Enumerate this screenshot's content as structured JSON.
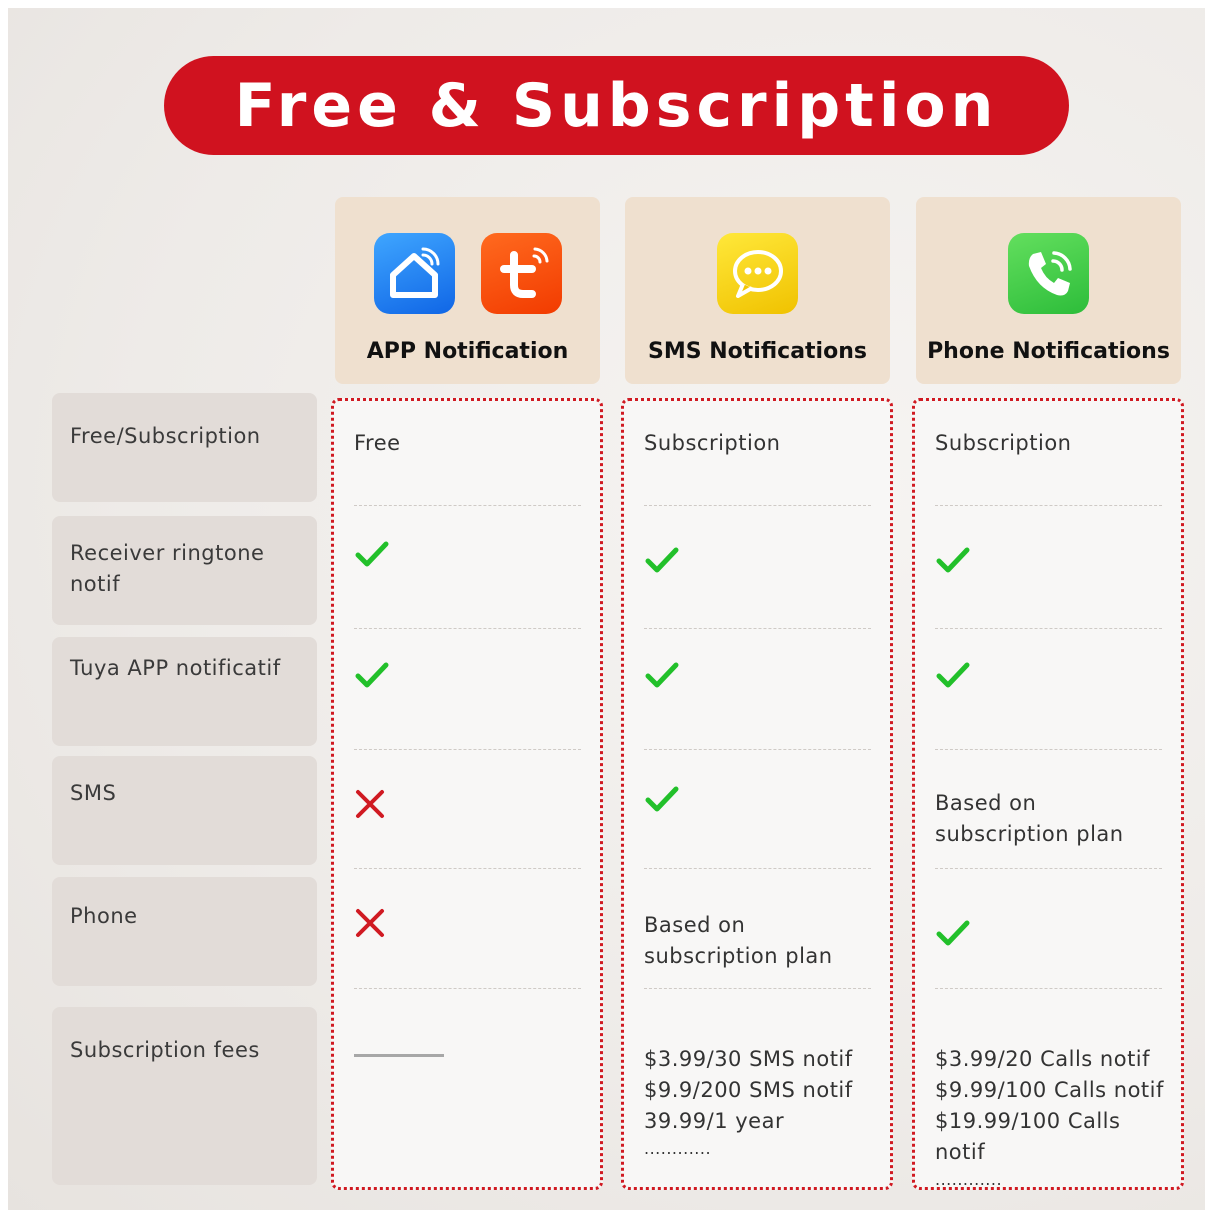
{
  "title": "Free & Subscription",
  "columns": [
    {
      "label": "APP Notification",
      "icons": [
        "smart-home-icon",
        "tuya-icon"
      ],
      "icon_colors": [
        "#1a7bf0",
        "#fb4a0c"
      ]
    },
    {
      "label": "SMS Notifications",
      "icons": [
        "sms-chat-icon"
      ],
      "icon_colors": [
        "#f7d20c"
      ]
    },
    {
      "label": "Phone Notifications",
      "icons": [
        "phone-call-icon"
      ],
      "icon_colors": [
        "#3ccc47"
      ]
    }
  ],
  "rows": [
    {
      "label": "Free/Subscription"
    },
    {
      "label": "Receiver ringtone notif"
    },
    {
      "label": "Tuya APP notificatif"
    },
    {
      "label": "SMS"
    },
    {
      "label": "Phone"
    },
    {
      "label": "Subscription fees"
    }
  ],
  "cells": {
    "app": {
      "free_subscription": "Free",
      "ringtone": "check",
      "tuya": "check",
      "sms": "cross",
      "phone": "cross",
      "fees": "dash"
    },
    "sms": {
      "free_subscription": "Subscription",
      "ringtone": "check",
      "tuya": "check",
      "sms": "check",
      "phone": "Based on subscription plan",
      "fees": [
        "$3.99/30 SMS notif",
        "$9.9/200 SMS notif",
        "39.99/1 year",
        "............"
      ]
    },
    "phone": {
      "free_subscription": "Subscription",
      "ringtone": "check",
      "tuya": "check",
      "sms": "Based on subscription plan",
      "phone": "check",
      "fees": [
        "$3.99/20 Calls notif",
        "$9.99/100 Calls notif",
        "$19.99/100 Calls notif",
        "............"
      ]
    }
  },
  "colors": {
    "banner": "#d0121f",
    "header_bg": "#efe0cf",
    "row_label_bg": "#e2dcd8",
    "column_border": "#d01a22",
    "check": "#22c02a",
    "cross": "#d01a22"
  }
}
